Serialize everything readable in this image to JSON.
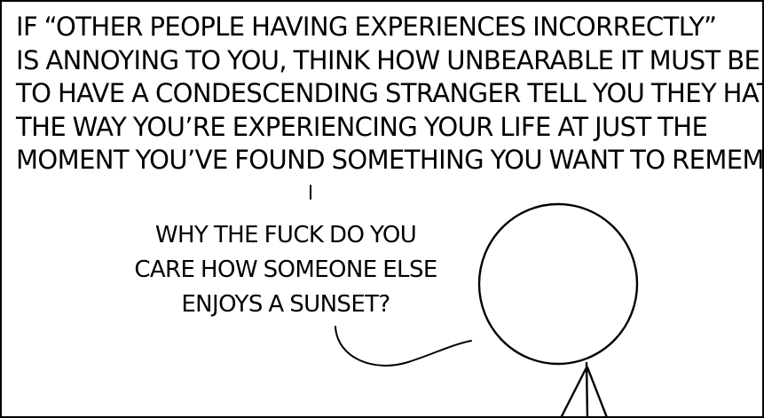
{
  "caption": {
    "lines": [
      "IF “OTHER PEOPLE HAVING EXPERIENCES INCORRECTLY”",
      "IS ANNOYING TO YOU, THINK HOW UNBEARABLE IT MUST BE",
      "TO HAVE A CONDESCENDING STRANGER TELL YOU THEY HATE",
      "THE WAY YOU’RE EXPERIENCING YOUR LIFE AT JUST THE",
      "MOMENT YOU’VE FOUND SOMETHING YOU WANT TO REMEMBER."
    ]
  },
  "speech": {
    "lines": [
      "WHY THE FUCK DO YOU",
      "CARE HOW SOMEONE ELSE",
      "ENJOYS A SUNSET?"
    ]
  },
  "colors": {
    "ink": "#000000",
    "paper": "#ffffff"
  }
}
